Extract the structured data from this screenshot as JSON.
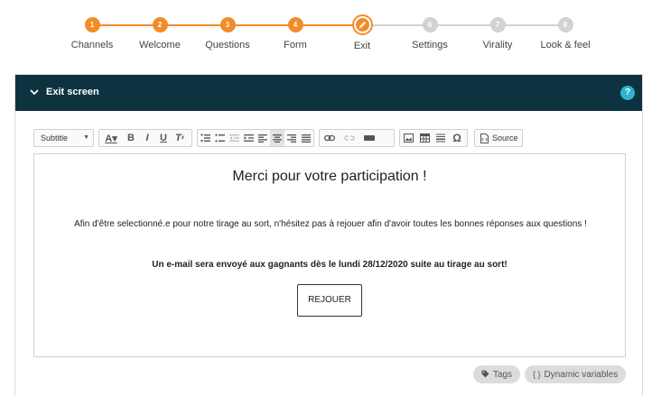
{
  "stepper": {
    "steps": [
      {
        "num": "1",
        "label": "Channels",
        "state": "done"
      },
      {
        "num": "2",
        "label": "Welcome",
        "state": "done"
      },
      {
        "num": "3",
        "label": "Questions",
        "state": "done"
      },
      {
        "num": "4",
        "label": "Form",
        "state": "done"
      },
      {
        "num": "",
        "label": "Exit",
        "state": "current",
        "icon": "pencil-icon"
      },
      {
        "num": "6",
        "label": "Settings",
        "state": "todo"
      },
      {
        "num": "7",
        "label": "Virality",
        "state": "todo"
      },
      {
        "num": "8",
        "label": "Look & feel",
        "state": "todo"
      }
    ],
    "colors": {
      "done": "#f28c28",
      "todo": "#d2d2d2"
    }
  },
  "panel": {
    "title": "Exit screen",
    "help_label": "?",
    "header_color": "#0d3340"
  },
  "toolbar": {
    "style_value": "Subtitle",
    "source_label": "Source"
  },
  "editor": {
    "title": "Merci pour votre participation !",
    "paragraph": "Afin d'être selectionné.e pour notre tirage au sort, n'hésitez pas à rejouer afin d'avoir toutes les bonnes réponses aux questions !",
    "bold_line": "Un e-mail sera envoyé aux gagnants dès le lundi 28/12/2020 suite au tirage au sort!",
    "button_label": "REJOUER"
  },
  "chips": {
    "tags_label": "Tags",
    "dynamic_label": "Dynamic variables"
  }
}
